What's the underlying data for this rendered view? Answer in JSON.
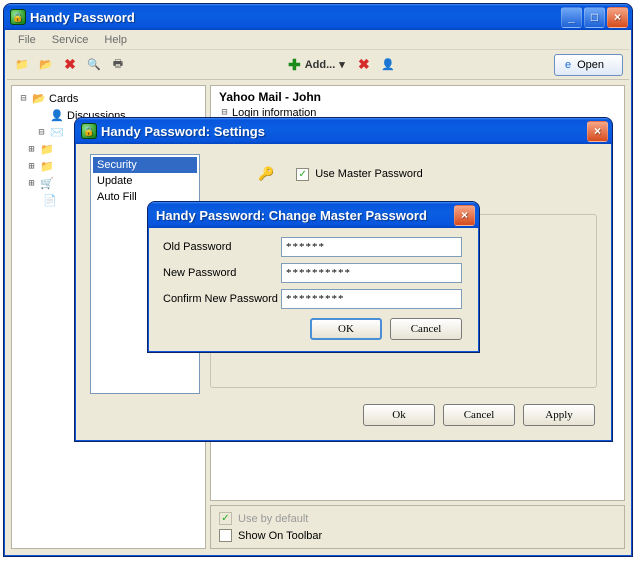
{
  "main": {
    "title": "Handy Password",
    "menus": [
      "File",
      "Service",
      "Help"
    ],
    "toolbar": {
      "add_label": "Add...",
      "open_label": "Open"
    },
    "tree": {
      "root": "Cards",
      "items": [
        "Discussions"
      ]
    },
    "details": {
      "header": "Yahoo Mail - John",
      "section": "Login information"
    },
    "footer": {
      "use_default": "Use by default",
      "show_toolbar": "Show On Toolbar"
    }
  },
  "settings": {
    "title": "Handy Password: Settings",
    "categories": [
      "Security",
      "Update",
      "Auto Fill"
    ],
    "use_master": "Use Master Password",
    "buttons": {
      "ok": "Ok",
      "cancel": "Cancel",
      "apply": "Apply"
    }
  },
  "cpw": {
    "title": "Handy Password: Change Master Password",
    "old_label": "Old Password",
    "new_label": "New Password",
    "confirm_label": "Confirm New Password",
    "old_value": "******",
    "new_value": "**********",
    "confirm_value": "*********",
    "ok": "OK",
    "cancel": "Cancel"
  }
}
